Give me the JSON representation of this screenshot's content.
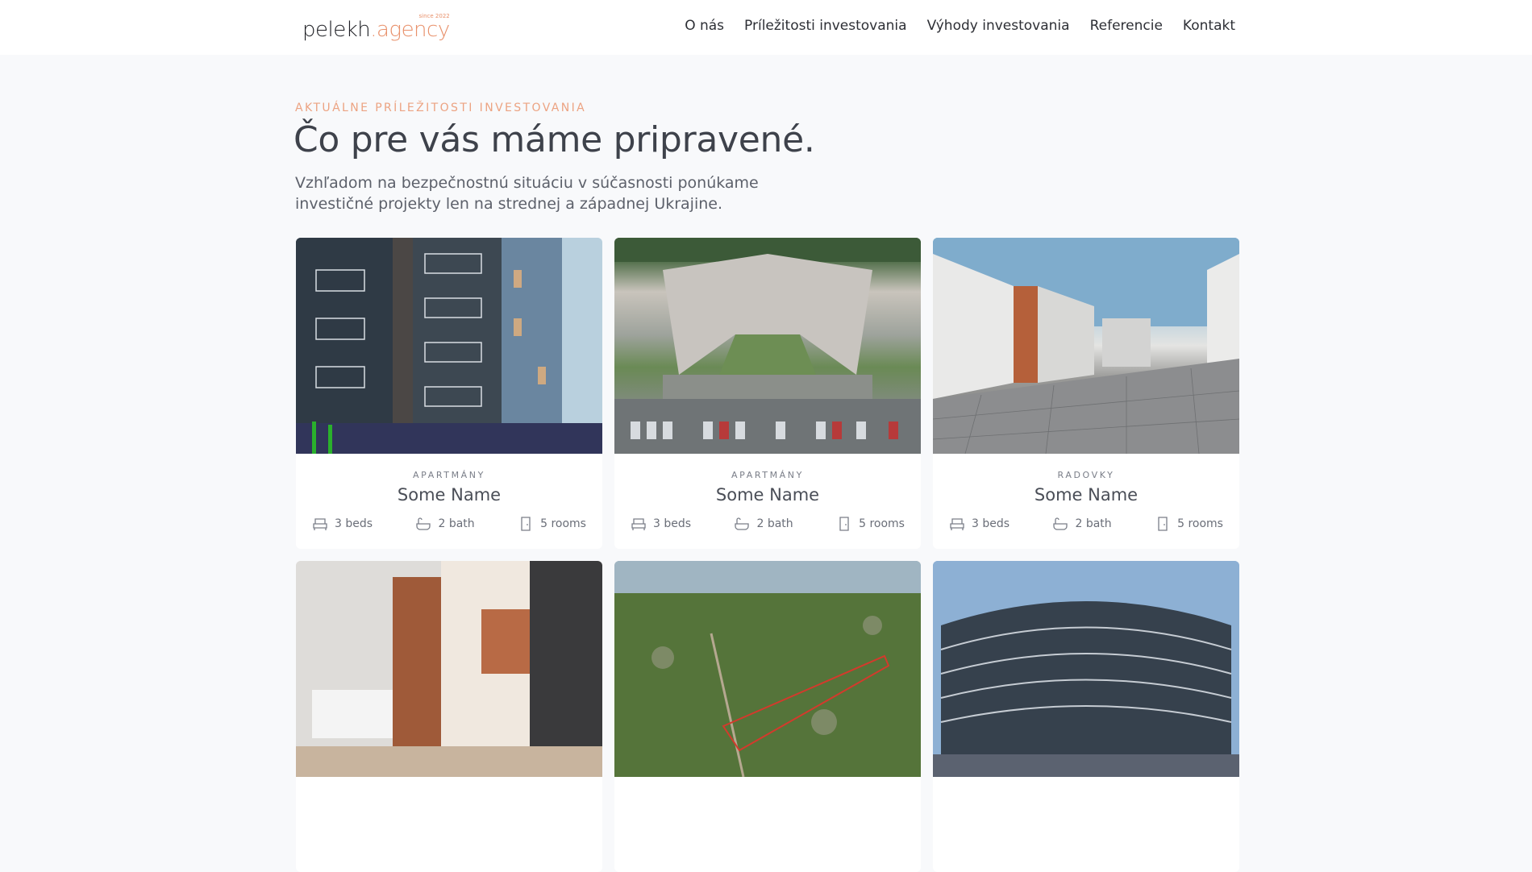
{
  "brand": {
    "base": "pelekh",
    "accent": ".agency",
    "since": "since 2022"
  },
  "nav": [
    "O nás",
    "Príležitosti investovania",
    "Výhody investovania",
    "Referencie",
    "Kontakt"
  ],
  "section": {
    "eyebrow": "AKTUÁLNE PRÍLEŽITOSTI INVESTOVANIA",
    "title": "Čo pre vás máme pripravené.",
    "lead": "Vzhľadom na bezpečnostnú situáciu v súčasnosti ponúkame investičné projekty len na strednej a západnej Ukrajine."
  },
  "cards": [
    {
      "category": "APARTMÁNY",
      "name": "Some Name",
      "beds": "3 beds",
      "bath": "2 bath",
      "rooms": "5 rooms"
    },
    {
      "category": "APARTMÁNY",
      "name": "Some Name",
      "beds": "3 beds",
      "bath": "2 bath",
      "rooms": "5 rooms"
    },
    {
      "category": "RADOVKY",
      "name": "Some Name",
      "beds": "3 beds",
      "bath": "2 bath",
      "rooms": "5 rooms"
    }
  ],
  "colors": {
    "accent": "#e8906a",
    "background": "#f8f9fb",
    "card": "#ffffff"
  }
}
